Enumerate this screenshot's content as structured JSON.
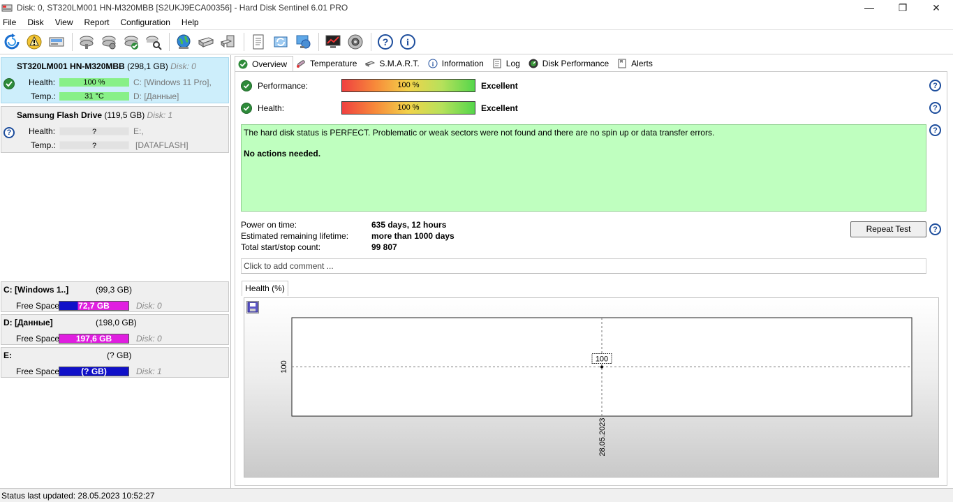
{
  "window": {
    "title": "Disk: 0, ST320LM001 HN-M320MBB [S2UKJ9ECA00356]  -  Hard Disk Sentinel 6.01 PRO",
    "minimize": "—",
    "restore": "❐",
    "close": "✕"
  },
  "menu": [
    "File",
    "Disk",
    "View",
    "Report",
    "Configuration",
    "Help"
  ],
  "toolbar": {
    "icons": [
      "refresh-icon",
      "alert-icon",
      "disk-image-icon",
      "disk-settings-icon",
      "disk-check-icon",
      "disk-ok-icon",
      "disk-search-icon",
      "globe-icon",
      "drive-icon",
      "drive-alt-icon",
      "document-icon",
      "sync-icon",
      "network-icon",
      "monitor-chart-icon",
      "speaker-icon",
      "help-icon",
      "info-icon"
    ]
  },
  "disks": [
    {
      "name": "ST320LM001 HN-M320MBB",
      "size": "(298,1 GB)",
      "disk": "Disk: 0",
      "health_label": "Health:",
      "health": "100 %",
      "health_pct": 100,
      "temp_label": "Temp.:",
      "temp": "31 °C",
      "part1": "C: [Windows 11 Pro],",
      "part2": "D: [Данные]",
      "status": "ok"
    },
    {
      "name": "Samsung Flash Drive",
      "size": "(119,5 GB)",
      "disk": "Disk: 1",
      "health_label": "Health:",
      "health": "?",
      "temp_label": "Temp.:",
      "temp": "?",
      "part1": "E:,",
      "part2": "[DATAFLASH]",
      "status": "unknown"
    }
  ],
  "volumes": [
    {
      "name": "C: [Windows 1..]",
      "size": "(99,3 GB)",
      "free_label": "Free Space",
      "free": "72,7 GB",
      "disk": "Disk: 0",
      "bar_color": "#e01ee0"
    },
    {
      "name": "D: [Данные]",
      "size": "(198,0 GB)",
      "free_label": "Free Space",
      "free": "197,6 GB",
      "disk": "Disk: 0",
      "bar_color": "#e01ee0"
    },
    {
      "name": "E:",
      "size": "(? GB)",
      "free_label": "Free Space",
      "free": "(? GB)",
      "disk": "Disk: 1",
      "bar_color": "#1010c8"
    }
  ],
  "tabs": [
    "Overview",
    "Temperature",
    "S.M.A.R.T.",
    "Information",
    "Log",
    "Disk Performance",
    "Alerts"
  ],
  "overview": {
    "performance_label": "Performance:",
    "performance_value": "100 %",
    "performance_status": "Excellent",
    "health_label": "Health:",
    "health_value": "100 %",
    "health_status": "Excellent",
    "status_text": "The hard disk status is PERFECT. Problematic or weak sectors were not found and there are no spin up or data transfer errors.",
    "status_action": "No actions needed.",
    "power_on_label": "Power on time:",
    "power_on_value": "635 days, 12 hours",
    "lifetime_label": "Estimated remaining lifetime:",
    "lifetime_value": "more than 1000 days",
    "startstop_label": "Total start/stop count:",
    "startstop_value": "99 807",
    "repeat_test": "Repeat Test",
    "comment_placeholder": "Click to add comment ...",
    "health_tab": "Health (%)"
  },
  "chart_data": {
    "type": "line",
    "x": [
      "28.05.2023"
    ],
    "series": [
      {
        "values": [
          100
        ]
      }
    ],
    "ytick_labels": [
      "100"
    ],
    "xtick_labels": [
      "28.05.2023"
    ],
    "point_label": "100"
  },
  "statusbar": "Status last updated: 28.05.2023 10:52:27",
  "colors": {
    "selected_disk_bg": "#cdeefb",
    "health_bar": "#88f088",
    "status_box": "#bfffbf",
    "accent_blue": "#1d4d9c",
    "ok_green": "#2e8b3a"
  }
}
